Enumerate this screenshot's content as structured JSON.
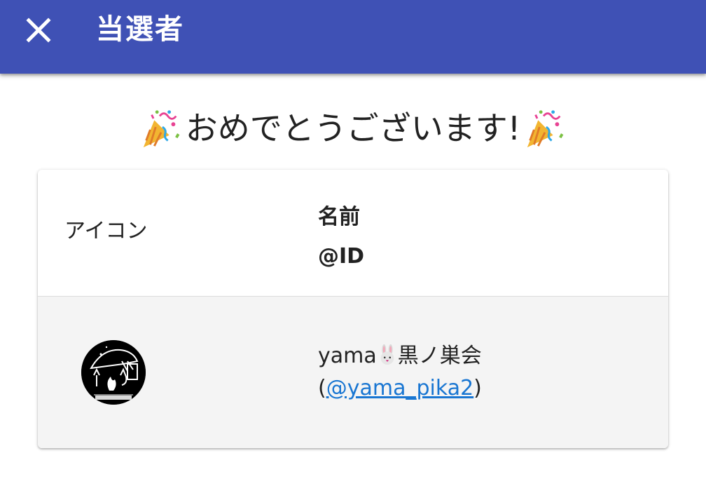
{
  "appbar": {
    "title": "当選者",
    "close_icon": "close-icon",
    "background": "#3f51b5"
  },
  "headline": {
    "text": "おめでとうございます!",
    "left_icon": "party-popper-icon",
    "right_icon": "party-popper-icon"
  },
  "table": {
    "headers": {
      "icon": "アイコン",
      "name": "名前",
      "id": "@ID"
    },
    "rows": [
      {
        "avatar_icon": "user-avatar-image",
        "name_prefix": "yama",
        "name_emoji": "rabbit-face-icon",
        "name_suffix": "黒ノ巣会",
        "id_open": "(",
        "id_link": "@yama_pika2",
        "id_close": ")"
      }
    ]
  },
  "colors": {
    "accent": "#3f51b5",
    "link": "#1976d2",
    "row_background": "#f4f4f4"
  }
}
